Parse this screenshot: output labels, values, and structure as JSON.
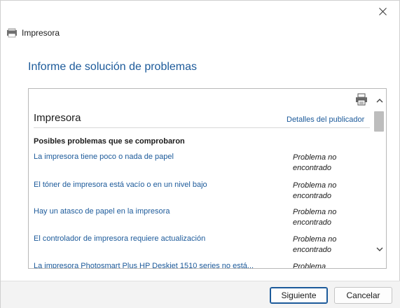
{
  "window": {
    "title": "Impresora",
    "close_icon": "close-icon",
    "app_icon": "printer-troubleshooter-icon"
  },
  "heading": "Informe de solución de problemas",
  "report": {
    "section_title": "Impresora",
    "publisher_link": "Detalles del publicador",
    "print_icon": "printer-icon",
    "subheading": "Posibles problemas que se comprobaron",
    "issues": [
      {
        "label": "La impresora tiene poco o nada de papel",
        "status": "Problema no encontrado"
      },
      {
        "label": "El tóner de impresora está vacío o en un nivel bajo",
        "status": "Problema no encontrado"
      },
      {
        "label": "Hay un atasco de papel en la impresora",
        "status": "Problema no encontrado"
      },
      {
        "label": "El controlador de impresora requiere actualización",
        "status": "Problema no encontrado"
      },
      {
        "label": "La impresora Photosmart Plus HP Deskjet 1510 series no está...",
        "status": "Problema"
      }
    ]
  },
  "footer": {
    "next_label": "Siguiente",
    "cancel_label": "Cancelar"
  },
  "colors": {
    "link": "#1c5a9a",
    "footer_bg": "#f3f3f3"
  }
}
